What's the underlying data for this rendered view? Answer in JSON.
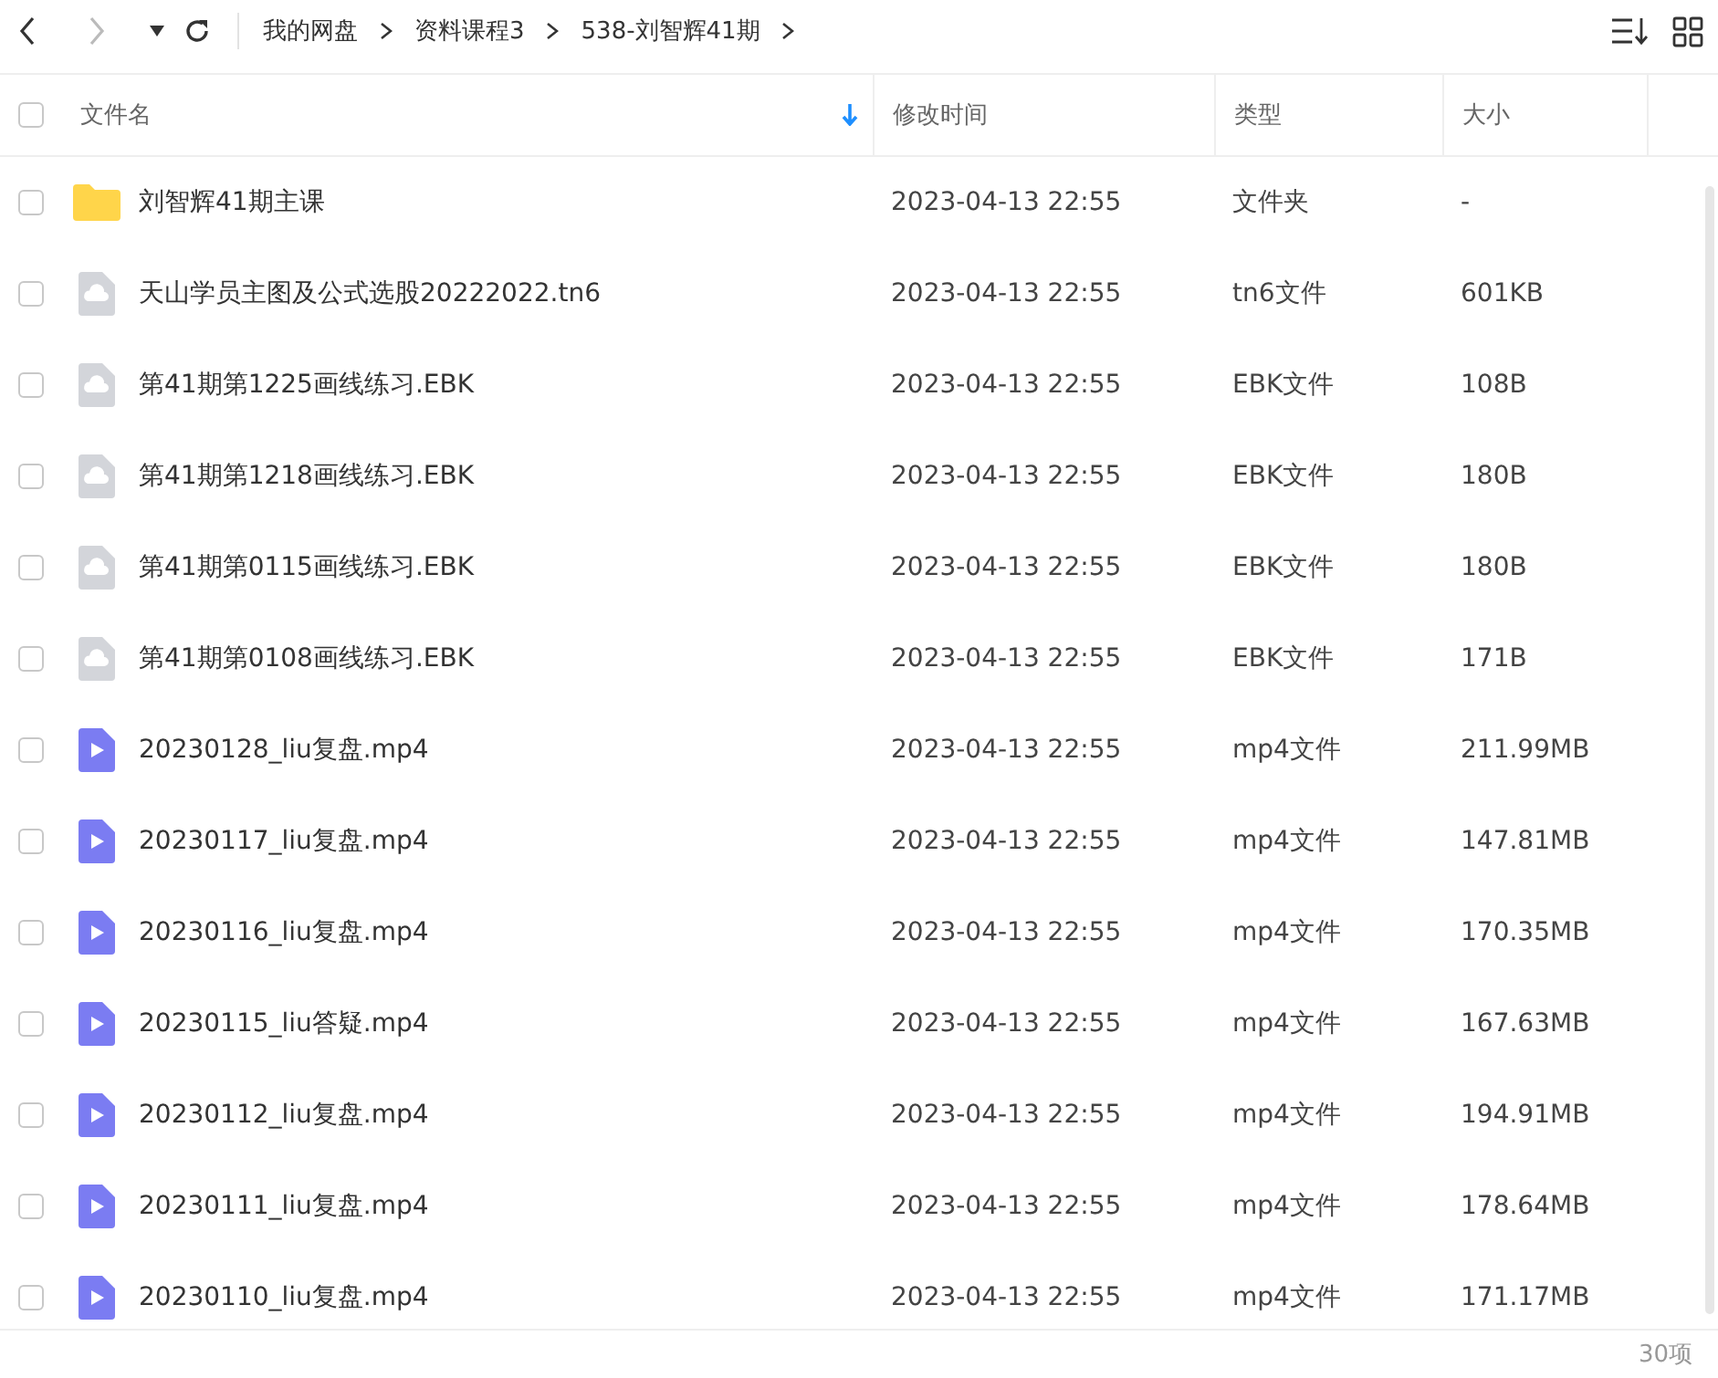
{
  "breadcrumb": [
    "我的网盘",
    "资料课程3",
    "538-刘智辉41期"
  ],
  "table": {
    "columns": [
      "文件名",
      "修改时间",
      "类型",
      "大小"
    ],
    "header_checked": false,
    "rows": [
      {
        "kind": "folder",
        "checked": false,
        "name": "刘智辉41期主课",
        "modified": "2023-04-13 22:55",
        "type": "文件夹",
        "size": "-"
      },
      {
        "kind": "file",
        "checked": false,
        "name": "天山学员主图及公式选股20222022.tn6",
        "modified": "2023-04-13 22:55",
        "type": "tn6文件",
        "size": "601KB"
      },
      {
        "kind": "file",
        "checked": false,
        "name": "第41期第1225画线练习.EBK",
        "modified": "2023-04-13 22:55",
        "type": "EBK文件",
        "size": "108B"
      },
      {
        "kind": "file",
        "checked": false,
        "name": "第41期第1218画线练习.EBK",
        "modified": "2023-04-13 22:55",
        "type": "EBK文件",
        "size": "180B"
      },
      {
        "kind": "file",
        "checked": false,
        "name": "第41期第0115画线练习.EBK",
        "modified": "2023-04-13 22:55",
        "type": "EBK文件",
        "size": "180B"
      },
      {
        "kind": "file",
        "checked": false,
        "name": "第41期第0108画线练习.EBK",
        "modified": "2023-04-13 22:55",
        "type": "EBK文件",
        "size": "171B"
      },
      {
        "kind": "video",
        "checked": false,
        "name": "20230128_liu复盘.mp4",
        "modified": "2023-04-13 22:55",
        "type": "mp4文件",
        "size": "211.99MB"
      },
      {
        "kind": "video",
        "checked": false,
        "name": "20230117_liu复盘.mp4",
        "modified": "2023-04-13 22:55",
        "type": "mp4文件",
        "size": "147.81MB"
      },
      {
        "kind": "video",
        "checked": false,
        "name": "20230116_liu复盘.mp4",
        "modified": "2023-04-13 22:55",
        "type": "mp4文件",
        "size": "170.35MB"
      },
      {
        "kind": "video",
        "checked": false,
        "name": "20230115_liu答疑.mp4",
        "modified": "2023-04-13 22:55",
        "type": "mp4文件",
        "size": "167.63MB"
      },
      {
        "kind": "video",
        "checked": false,
        "name": "20230112_liu复盘.mp4",
        "modified": "2023-04-13 22:55",
        "type": "mp4文件",
        "size": "194.91MB"
      },
      {
        "kind": "video",
        "checked": false,
        "name": "20230111_liu复盘.mp4",
        "modified": "2023-04-13 22:55",
        "type": "mp4文件",
        "size": "178.64MB"
      },
      {
        "kind": "video",
        "checked": false,
        "name": "20230110_liu复盘.mp4",
        "modified": "2023-04-13 22:55",
        "type": "mp4文件",
        "size": "171.17MB"
      }
    ]
  },
  "status_bar": {
    "count": "30项"
  }
}
